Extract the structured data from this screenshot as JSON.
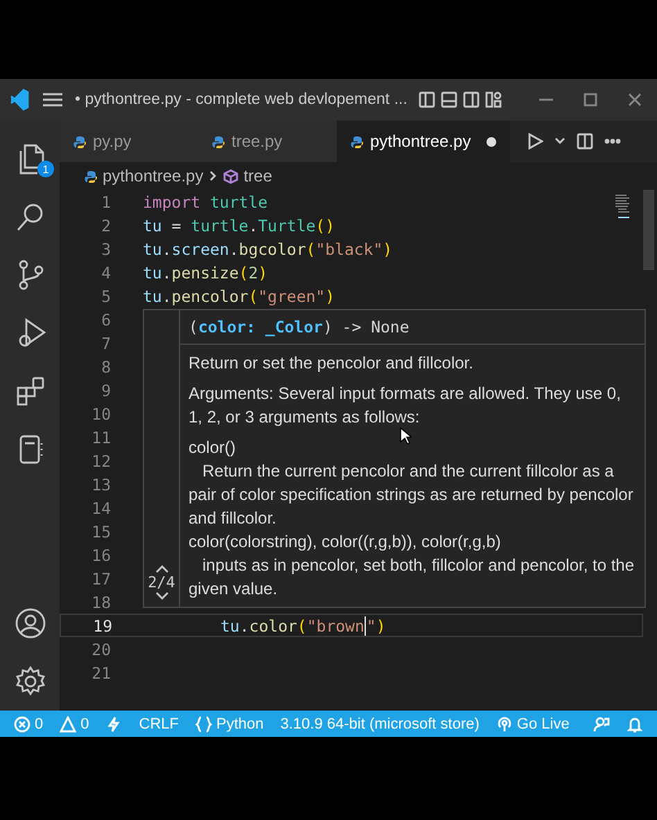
{
  "title_bar": {
    "title": "• pythontree.py - complete web devlopement ..."
  },
  "activity_bar": {
    "top": [
      {
        "kind": "explorer",
        "badge": "1"
      },
      {
        "kind": "search"
      },
      {
        "kind": "source-control"
      },
      {
        "kind": "run-debug"
      },
      {
        "kind": "extensions"
      },
      {
        "kind": "notebook"
      }
    ],
    "bottom": [
      {
        "kind": "account"
      },
      {
        "kind": "settings"
      }
    ]
  },
  "tabs": [
    {
      "label": "py.py",
      "selected": false,
      "modified": false
    },
    {
      "label": "tree.py",
      "selected": false,
      "modified": false
    },
    {
      "label": "pythontree.py",
      "selected": true,
      "modified": true
    }
  ],
  "breadcrumb": [
    {
      "label": "pythontree.py",
      "kind": "file"
    },
    {
      "label": "tree",
      "kind": "module"
    }
  ],
  "editor": {
    "lines": [
      {
        "number": "1",
        "current": false,
        "tokens": [
          {
            "text": "import",
            "kind": "keyword"
          },
          {
            "text": " turtle",
            "kind": "module"
          }
        ]
      },
      {
        "number": "2",
        "current": false,
        "tokens": [
          {
            "text": "tu",
            "kind": "var"
          },
          {
            "text": " = ",
            "kind": "plain"
          },
          {
            "text": "turtle",
            "kind": "module"
          },
          {
            "text": ".",
            "kind": "plain"
          },
          {
            "text": "Turtle",
            "kind": "module"
          },
          {
            "text": "()",
            "kind": "bracket"
          }
        ]
      },
      {
        "number": "3",
        "current": false,
        "tokens": [
          {
            "text": "tu",
            "kind": "var"
          },
          {
            "text": ".",
            "kind": "plain"
          },
          {
            "text": "screen",
            "kind": "var"
          },
          {
            "text": ".",
            "kind": "plain"
          },
          {
            "text": "bgcolor",
            "kind": "func"
          },
          {
            "text": "(",
            "kind": "bracket"
          },
          {
            "text": "\"black\"",
            "kind": "string"
          },
          {
            "text": ")",
            "kind": "bracket"
          }
        ]
      },
      {
        "number": "4",
        "current": false,
        "tokens": [
          {
            "text": "tu",
            "kind": "var"
          },
          {
            "text": ".",
            "kind": "plain"
          },
          {
            "text": "pensize",
            "kind": "func"
          },
          {
            "text": "(",
            "kind": "bracket"
          },
          {
            "text": "2",
            "kind": "number"
          },
          {
            "text": ")",
            "kind": "bracket"
          }
        ]
      },
      {
        "number": "5",
        "current": false,
        "tokens": [
          {
            "text": "tu",
            "kind": "var"
          },
          {
            "text": ".",
            "kind": "plain"
          },
          {
            "text": "pencolor",
            "kind": "func"
          },
          {
            "text": "(",
            "kind": "bracket"
          },
          {
            "text": "\"green\"",
            "kind": "string"
          },
          {
            "text": ")",
            "kind": "bracket"
          }
        ]
      },
      {
        "number": "6",
        "current": false
      },
      {
        "number": "7",
        "current": false
      },
      {
        "number": "8",
        "current": false
      },
      {
        "number": "9",
        "current": false
      },
      {
        "number": "10",
        "current": false
      },
      {
        "number": "11",
        "current": false
      },
      {
        "number": "12",
        "current": false
      },
      {
        "number": "13",
        "current": false
      },
      {
        "number": "14",
        "current": false
      },
      {
        "number": "15",
        "current": false
      },
      {
        "number": "16",
        "current": false
      },
      {
        "number": "17",
        "current": false
      },
      {
        "number": "18",
        "current": false
      },
      {
        "number": "19",
        "current": true,
        "indented": true,
        "tokens": [
          {
            "text": "tu",
            "kind": "var"
          },
          {
            "text": ".",
            "kind": "plain"
          },
          {
            "text": "color",
            "kind": "func"
          },
          {
            "text": "(",
            "kind": "bracket"
          },
          {
            "text": "\"brown",
            "kind": "string"
          },
          {
            "kind": "cursor"
          },
          {
            "text": "\"",
            "kind": "string"
          },
          {
            "text": ")",
            "kind": "bracket"
          }
        ]
      },
      {
        "number": "20",
        "current": false
      },
      {
        "number": "21",
        "current": false
      }
    ]
  },
  "hover": {
    "counter": "2/4",
    "signature": [
      {
        "text": "(",
        "kind": "plain"
      },
      {
        "text": "color:",
        "kind": "param"
      },
      {
        "text": " _Color",
        "kind": "param"
      },
      {
        "text": ") -> None",
        "kind": "plain"
      }
    ],
    "doc": [
      {
        "kind": "paragraph",
        "text": "Return or set the pencolor and fillcolor."
      },
      {
        "kind": "paragraph",
        "text": "Arguments: Several input formats are allowed. They use 0, 1, 2, or 3 arguments as follows:"
      },
      {
        "kind": "call",
        "text": "color()"
      },
      {
        "kind": "description",
        "text": "Return the current pencolor and the current fillcolor as a pair of color specification strings as are returned by pencolor and fillcolor."
      },
      {
        "kind": "call",
        "text": "color(colorstring), color((r,g,b)), color(r,g,b)"
      },
      {
        "kind": "description",
        "text": "inputs as in pencolor, set both, fillcolor and pencolor, to the given value."
      }
    ]
  },
  "status_bar": [
    {
      "kind": "errors",
      "text": "0"
    },
    {
      "kind": "warnings",
      "text": "0"
    },
    {
      "kind": "lightning"
    },
    {
      "kind": "text",
      "text": "CRLF"
    },
    {
      "kind": "language",
      "text": "Python"
    },
    {
      "kind": "text",
      "text": "3.10.9 64-bit (microsoft store)"
    },
    {
      "kind": "live",
      "text": "Go Live"
    },
    {
      "kind": "feedback"
    },
    {
      "kind": "bell"
    }
  ]
}
